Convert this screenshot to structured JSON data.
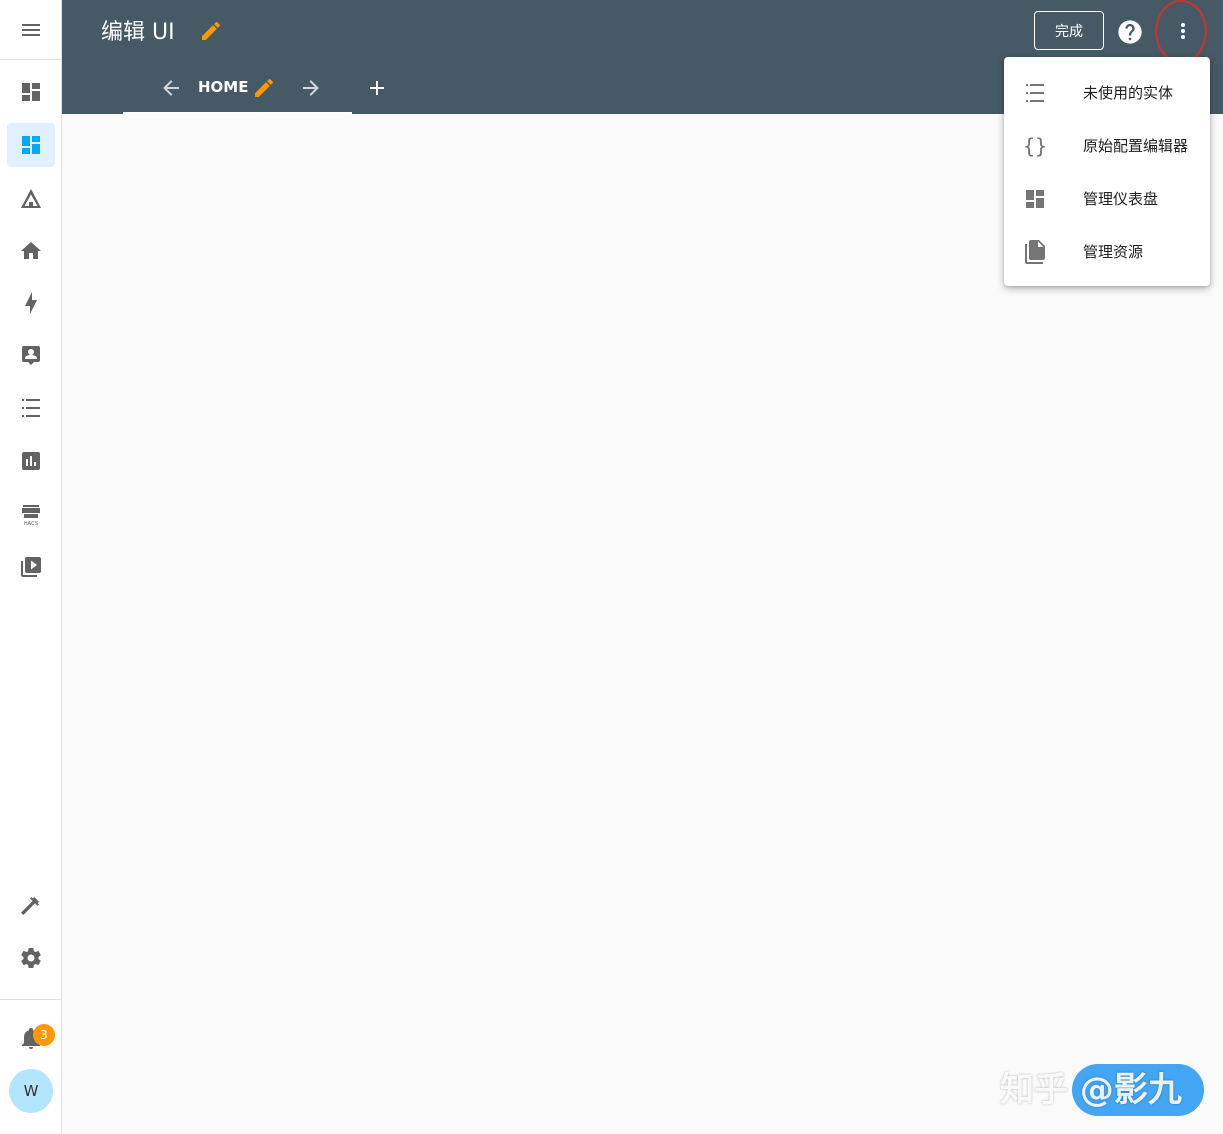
{
  "header": {
    "title": "编辑 UI",
    "done_label": "完成"
  },
  "tabs": [
    {
      "label": "HOME"
    }
  ],
  "menu": {
    "items": [
      {
        "label": "未使用的实体",
        "icon": "format-list-checks-icon"
      },
      {
        "label": "原始配置编辑器",
        "icon": "code-braces-icon"
      },
      {
        "label": "管理仪表盘",
        "icon": "view-dashboard-icon"
      },
      {
        "label": "管理资源",
        "icon": "file-multiple-icon"
      }
    ]
  },
  "sidebar": {
    "notification_count": "3",
    "avatar_initial": "W"
  },
  "watermark": "知乎 @影九",
  "colors": {
    "header_bg": "#455a64",
    "accent": "#03a9f4",
    "edit_icon": "#ff9800",
    "badge": "#ff9800"
  }
}
